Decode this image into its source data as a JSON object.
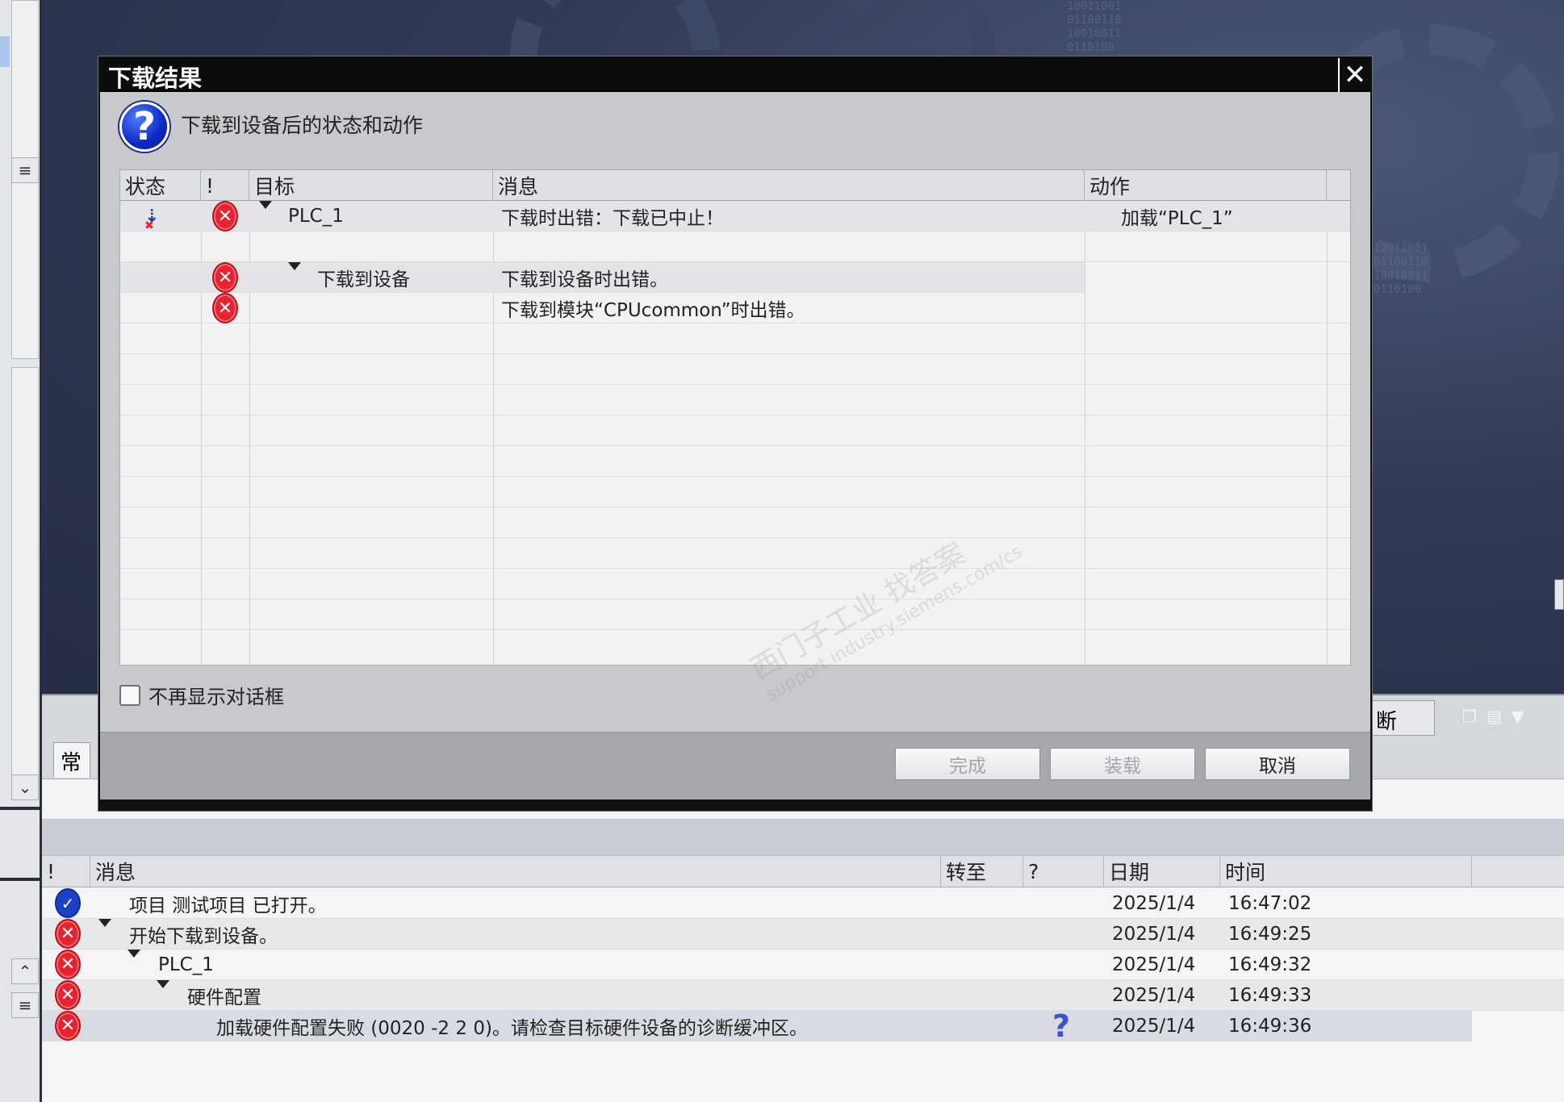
{
  "dialog": {
    "title": "下载结果",
    "close_glyph": "✕",
    "subtitle": "下载到设备后的状态和动作",
    "columns": [
      "状态",
      "!",
      "目标",
      "消息",
      "动作"
    ],
    "rows": [
      {
        "target": "PLC_1",
        "message": "下载时出错：下载已中止！",
        "action": "加载“PLC_1”",
        "status_icon": "download-error-icon",
        "severity_icon": "error-icon",
        "expanded": true
      },
      {
        "target": "",
        "message": "",
        "action": ""
      },
      {
        "target": "下载到设备",
        "message": "下载到设备时出错。",
        "action": "",
        "severity_icon": "error-icon",
        "expanded": true
      },
      {
        "target": "",
        "message": "下载到模块“CPUcommon”时出错。",
        "action": "",
        "severity_icon": "error-icon"
      }
    ],
    "checkbox_label": "不再显示对话框",
    "buttons": {
      "finish": "完成",
      "load": "装载",
      "cancel": "取消"
    },
    "watermark": {
      "line1": "西门子工业   找答案",
      "line2": "support.industry.siemens.com/cs"
    }
  },
  "background": {
    "tab_common": "常",
    "tab_diag": "断",
    "binary_text": "10011001\n01100110\n10010011\n0110100"
  },
  "log": {
    "columns": [
      "!",
      "消息",
      "转至",
      "?",
      "日期",
      "时间"
    ],
    "rows": [
      {
        "icon": "ok",
        "message": "项目 测试项目 已打开。",
        "help": "",
        "date": "2025/1/4",
        "time": "16:47:02",
        "indent": 0,
        "expand": false
      },
      {
        "icon": "error",
        "message": "开始下载到设备。",
        "help": "",
        "date": "2025/1/4",
        "time": "16:49:25",
        "indent": 0,
        "expand": true
      },
      {
        "icon": "error",
        "message": "PLC_1",
        "help": "",
        "date": "2025/1/4",
        "time": "16:49:32",
        "indent": 1,
        "expand": true
      },
      {
        "icon": "error",
        "message": "硬件配置",
        "help": "",
        "date": "2025/1/4",
        "time": "16:49:33",
        "indent": 2,
        "expand": true
      },
      {
        "icon": "error",
        "message": "加载硬件配置失败 (0020 -2 2 0)。请检查目标硬件设备的诊断缓冲区。",
        "help": "?",
        "date": "2025/1/4",
        "time": "16:49:36",
        "indent": 3,
        "expand": false
      }
    ]
  }
}
